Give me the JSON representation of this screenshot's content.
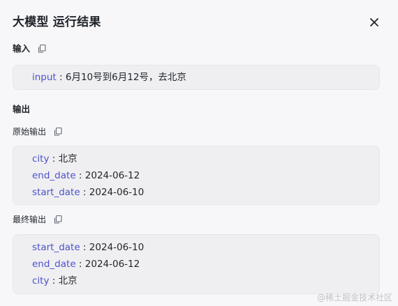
{
  "dialog": {
    "title": "大模型 运行结果"
  },
  "input_section": {
    "label": "输入",
    "rows": [
      {
        "key": "input",
        "sep": " : ",
        "value": "6月10号到6月12号，去北京"
      }
    ]
  },
  "output_section": {
    "label": "输出",
    "raw": {
      "label": "原始输出",
      "rows": [
        {
          "key": "city",
          "sep": " : ",
          "value": "北京"
        },
        {
          "key": "end_date",
          "sep": " : ",
          "value": "2024-06-12"
        },
        {
          "key": "start_date",
          "sep": " : ",
          "value": "2024-06-10"
        }
      ]
    },
    "final": {
      "label": "最终输出",
      "rows": [
        {
          "key": "start_date",
          "sep": " : ",
          "value": "2024-06-10"
        },
        {
          "key": "end_date",
          "sep": " : ",
          "value": "2024-06-12"
        },
        {
          "key": "city",
          "sep": " : ",
          "value": "北京"
        }
      ]
    }
  },
  "watermark": "@稀土掘金技术社区",
  "colors": {
    "key": "#4b52c9",
    "box_bg": "#efeff1",
    "panel_bg": "#f7f7f9"
  },
  "icons": {
    "close": "close-icon",
    "copy": "copy-icon"
  }
}
